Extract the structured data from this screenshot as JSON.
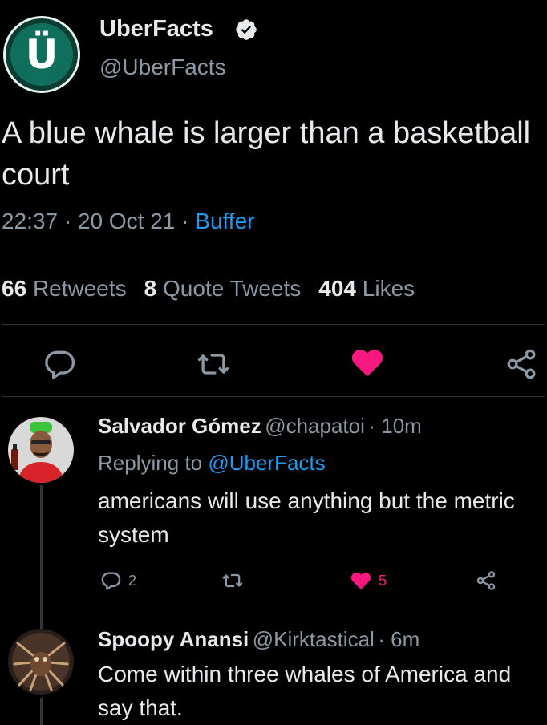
{
  "tweet": {
    "author_name": "UberFacts",
    "author_handle": "@UberFacts",
    "avatar_letter": "Ü",
    "text": "A blue whale is larger than a basketball court",
    "time": "22:37",
    "date": "20 Oct 21",
    "source": "Buffer",
    "stats": {
      "retweets_count": "66",
      "retweets_label": "Retweets",
      "quotes_count": "8",
      "quotes_label": "Quote Tweets",
      "likes_count": "404",
      "likes_label": "Likes"
    },
    "actions": [
      "reply-icon",
      "retweet-icon",
      "like-icon-filled",
      "share-icon"
    ]
  },
  "replies": [
    {
      "name": "Salvador Gómez",
      "handle": "@chapatoi",
      "time": "10m",
      "replying_prefix": "Replying to",
      "replying_to": "@UberFacts",
      "text": "americans will use anything but the metric system",
      "reply_count": "2",
      "like_count": "5"
    },
    {
      "name": "Spoopy Anansi",
      "handle": "@Kirktastical",
      "time": "6m",
      "text": "Come within three whales of America and say that."
    }
  ],
  "colors": {
    "background": "#000000",
    "text": "#e7e9ea",
    "muted": "#8b98a5",
    "link": "#1d9bf0",
    "like": "#f91880",
    "divider": "#2f3336"
  }
}
